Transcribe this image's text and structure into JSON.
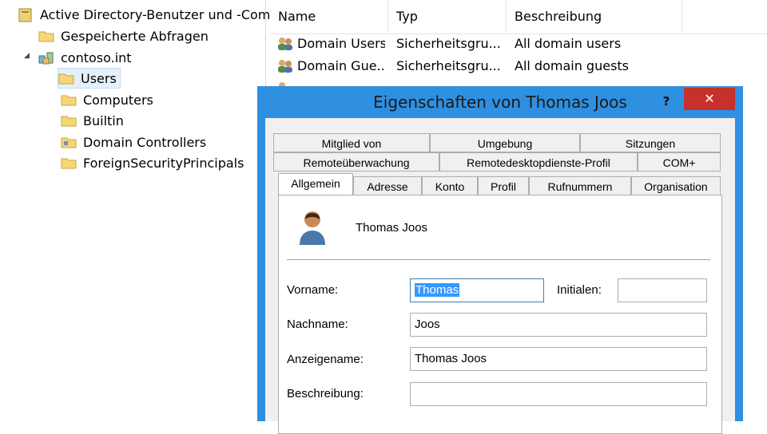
{
  "tree": {
    "root": "Active Directory-Benutzer und -Com",
    "saved_queries": "Gespeicherte Abfragen",
    "domain": "contoso.int",
    "children": [
      "Users",
      "Computers",
      "Builtin",
      "Domain Controllers",
      "ForeignSecurityPrincipals"
    ]
  },
  "list": {
    "columns": [
      "Name",
      "Typ",
      "Beschreibung"
    ],
    "rows": [
      {
        "name": "Domain Users",
        "type": "Sicherheitsgru...",
        "desc": "All domain users"
      },
      {
        "name": "Domain Gue...",
        "type": "Sicherheitsgru...",
        "desc": "All domain guests"
      }
    ]
  },
  "dialog": {
    "title": "Eigenschaften von Thomas Joos",
    "help": "?",
    "close": "✕",
    "tabs_row1": [
      "Mitglied von",
      "Umgebung",
      "Sitzungen"
    ],
    "tabs_row2": [
      "Remoteüberwachung",
      "Remotedesktopdienste-Profil",
      "COM+"
    ],
    "tabs_row3": [
      "Allgemein",
      "Adresse",
      "Konto",
      "Profil",
      "Rufnummern",
      "Organisation"
    ],
    "user_name": "Thomas Joos",
    "fields": {
      "vorname_label": "Vorname:",
      "vorname_value": "Thomas",
      "initialen_label": "Initialen:",
      "initialen_value": "",
      "nachname_label": "Nachname:",
      "nachname_value": "Joos",
      "anzeigename_label": "Anzeigename:",
      "anzeigename_value": "Thomas Joos",
      "beschreibung_label": "Beschreibung:",
      "beschreibung_value": ""
    }
  },
  "colors": {
    "dialog_frame": "#2f8fe0",
    "close_button": "#c7302b",
    "selection": "#3399ff"
  }
}
